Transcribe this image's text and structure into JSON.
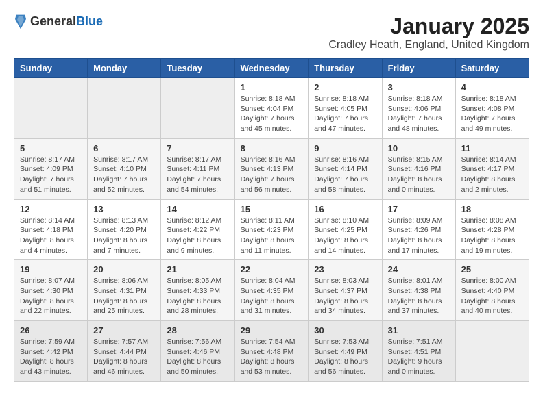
{
  "header": {
    "logo": {
      "general": "General",
      "blue": "Blue"
    },
    "month": "January 2025",
    "location": "Cradley Heath, England, United Kingdom"
  },
  "weekdays": [
    "Sunday",
    "Monday",
    "Tuesday",
    "Wednesday",
    "Thursday",
    "Friday",
    "Saturday"
  ],
  "weeks": [
    [
      {
        "day": "",
        "info": ""
      },
      {
        "day": "",
        "info": ""
      },
      {
        "day": "",
        "info": ""
      },
      {
        "day": "1",
        "info": "Sunrise: 8:18 AM\nSunset: 4:04 PM\nDaylight: 7 hours\nand 45 minutes."
      },
      {
        "day": "2",
        "info": "Sunrise: 8:18 AM\nSunset: 4:05 PM\nDaylight: 7 hours\nand 47 minutes."
      },
      {
        "day": "3",
        "info": "Sunrise: 8:18 AM\nSunset: 4:06 PM\nDaylight: 7 hours\nand 48 minutes."
      },
      {
        "day": "4",
        "info": "Sunrise: 8:18 AM\nSunset: 4:08 PM\nDaylight: 7 hours\nand 49 minutes."
      }
    ],
    [
      {
        "day": "5",
        "info": "Sunrise: 8:17 AM\nSunset: 4:09 PM\nDaylight: 7 hours\nand 51 minutes."
      },
      {
        "day": "6",
        "info": "Sunrise: 8:17 AM\nSunset: 4:10 PM\nDaylight: 7 hours\nand 52 minutes."
      },
      {
        "day": "7",
        "info": "Sunrise: 8:17 AM\nSunset: 4:11 PM\nDaylight: 7 hours\nand 54 minutes."
      },
      {
        "day": "8",
        "info": "Sunrise: 8:16 AM\nSunset: 4:13 PM\nDaylight: 7 hours\nand 56 minutes."
      },
      {
        "day": "9",
        "info": "Sunrise: 8:16 AM\nSunset: 4:14 PM\nDaylight: 7 hours\nand 58 minutes."
      },
      {
        "day": "10",
        "info": "Sunrise: 8:15 AM\nSunset: 4:16 PM\nDaylight: 8 hours\nand 0 minutes."
      },
      {
        "day": "11",
        "info": "Sunrise: 8:14 AM\nSunset: 4:17 PM\nDaylight: 8 hours\nand 2 minutes."
      }
    ],
    [
      {
        "day": "12",
        "info": "Sunrise: 8:14 AM\nSunset: 4:18 PM\nDaylight: 8 hours\nand 4 minutes."
      },
      {
        "day": "13",
        "info": "Sunrise: 8:13 AM\nSunset: 4:20 PM\nDaylight: 8 hours\nand 7 minutes."
      },
      {
        "day": "14",
        "info": "Sunrise: 8:12 AM\nSunset: 4:22 PM\nDaylight: 8 hours\nand 9 minutes."
      },
      {
        "day": "15",
        "info": "Sunrise: 8:11 AM\nSunset: 4:23 PM\nDaylight: 8 hours\nand 11 minutes."
      },
      {
        "day": "16",
        "info": "Sunrise: 8:10 AM\nSunset: 4:25 PM\nDaylight: 8 hours\nand 14 minutes."
      },
      {
        "day": "17",
        "info": "Sunrise: 8:09 AM\nSunset: 4:26 PM\nDaylight: 8 hours\nand 17 minutes."
      },
      {
        "day": "18",
        "info": "Sunrise: 8:08 AM\nSunset: 4:28 PM\nDaylight: 8 hours\nand 19 minutes."
      }
    ],
    [
      {
        "day": "19",
        "info": "Sunrise: 8:07 AM\nSunset: 4:30 PM\nDaylight: 8 hours\nand 22 minutes."
      },
      {
        "day": "20",
        "info": "Sunrise: 8:06 AM\nSunset: 4:31 PM\nDaylight: 8 hours\nand 25 minutes."
      },
      {
        "day": "21",
        "info": "Sunrise: 8:05 AM\nSunset: 4:33 PM\nDaylight: 8 hours\nand 28 minutes."
      },
      {
        "day": "22",
        "info": "Sunrise: 8:04 AM\nSunset: 4:35 PM\nDaylight: 8 hours\nand 31 minutes."
      },
      {
        "day": "23",
        "info": "Sunrise: 8:03 AM\nSunset: 4:37 PM\nDaylight: 8 hours\nand 34 minutes."
      },
      {
        "day": "24",
        "info": "Sunrise: 8:01 AM\nSunset: 4:38 PM\nDaylight: 8 hours\nand 37 minutes."
      },
      {
        "day": "25",
        "info": "Sunrise: 8:00 AM\nSunset: 4:40 PM\nDaylight: 8 hours\nand 40 minutes."
      }
    ],
    [
      {
        "day": "26",
        "info": "Sunrise: 7:59 AM\nSunset: 4:42 PM\nDaylight: 8 hours\nand 43 minutes."
      },
      {
        "day": "27",
        "info": "Sunrise: 7:57 AM\nSunset: 4:44 PM\nDaylight: 8 hours\nand 46 minutes."
      },
      {
        "day": "28",
        "info": "Sunrise: 7:56 AM\nSunset: 4:46 PM\nDaylight: 8 hours\nand 50 minutes."
      },
      {
        "day": "29",
        "info": "Sunrise: 7:54 AM\nSunset: 4:48 PM\nDaylight: 8 hours\nand 53 minutes."
      },
      {
        "day": "30",
        "info": "Sunrise: 7:53 AM\nSunset: 4:49 PM\nDaylight: 8 hours\nand 56 minutes."
      },
      {
        "day": "31",
        "info": "Sunrise: 7:51 AM\nSunset: 4:51 PM\nDaylight: 9 hours\nand 0 minutes."
      },
      {
        "day": "",
        "info": ""
      }
    ]
  ]
}
